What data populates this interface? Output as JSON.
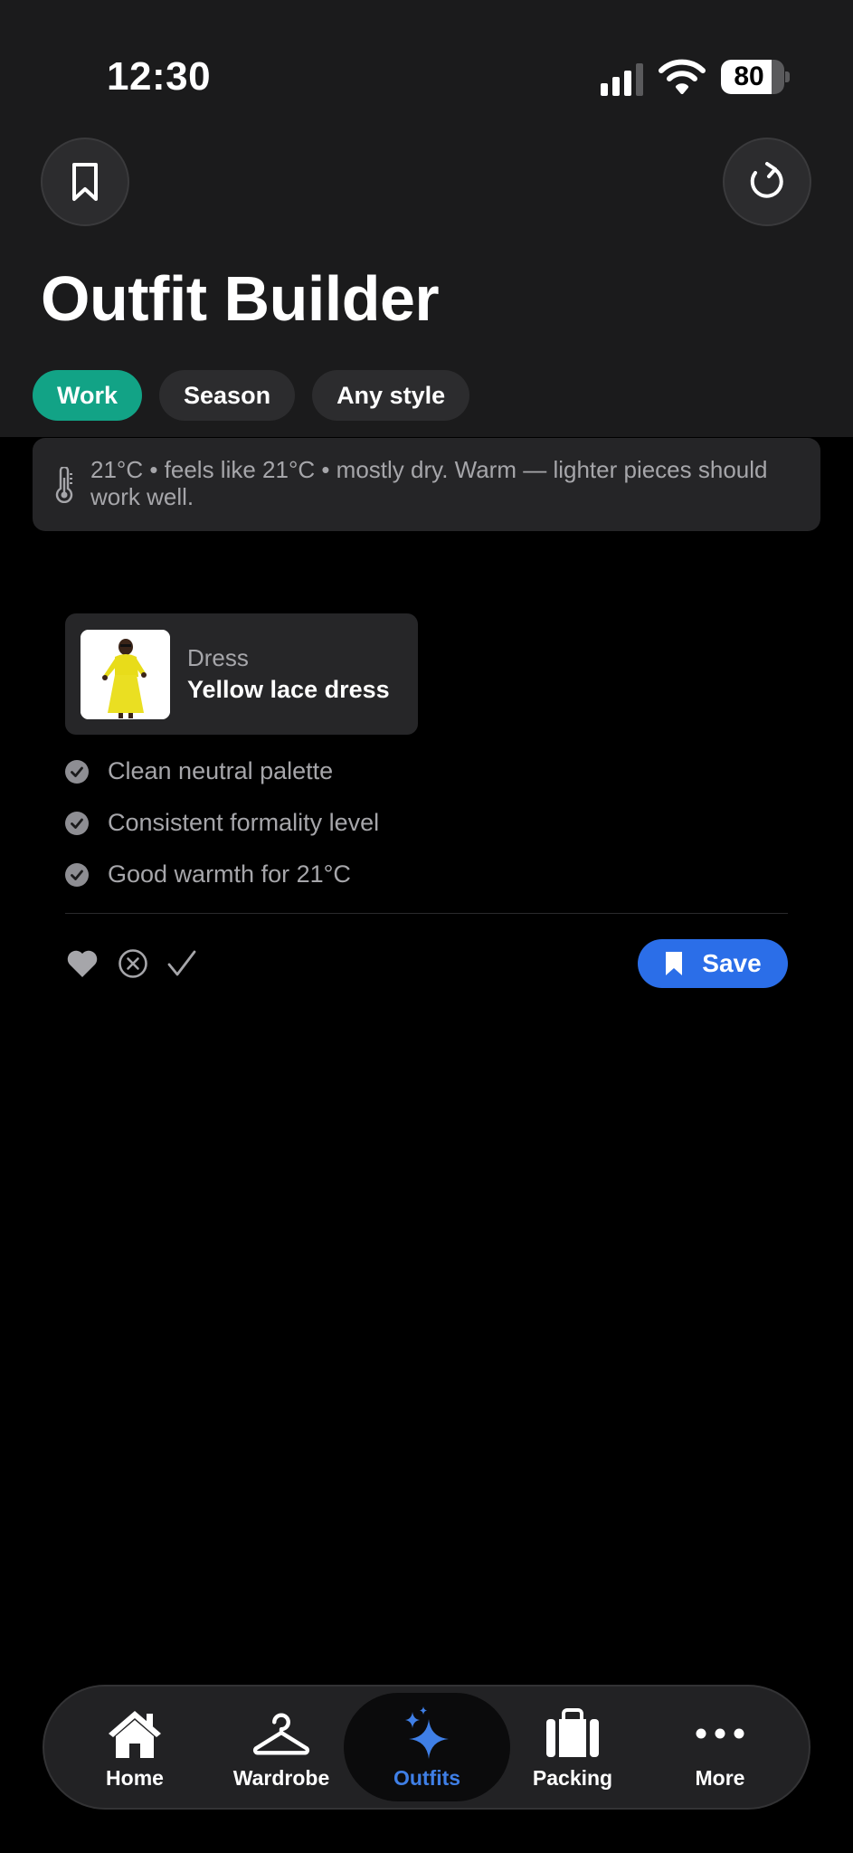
{
  "status_bar": {
    "time": "12:30",
    "battery_percent": "80",
    "battery_level": 0.8
  },
  "header": {
    "title": "Outfit Builder",
    "left_button_icon": "bookmark-icon",
    "right_button_icon": "refresh-icon"
  },
  "filters": [
    {
      "label": "Work",
      "active": true
    },
    {
      "label": "Season",
      "active": false
    },
    {
      "label": "Any style",
      "active": false
    }
  ],
  "weather": {
    "icon": "thermometer-icon",
    "text": "21°C • feels like 21°C • mostly dry. Warm — lighter pieces should work well."
  },
  "outfit": {
    "items": [
      {
        "category": "Dress",
        "name": "Yellow lace dress",
        "thumbnail": "yellow-dress-photo"
      }
    ],
    "reasons": [
      "Clean neutral palette",
      "Consistent formality level",
      "Good warmth for 21°C"
    ],
    "actions": {
      "like_icon": "heart-icon",
      "dismiss_icon": "x-circle-icon",
      "done_icon": "checkmark-icon",
      "save_label": "Save"
    }
  },
  "tab_bar": [
    {
      "label": "Home",
      "icon": "house-icon",
      "active": false
    },
    {
      "label": "Wardrobe",
      "icon": "hanger-icon",
      "active": false
    },
    {
      "label": "Outfits",
      "icon": "sparkles-icon",
      "active": true
    },
    {
      "label": "Packing",
      "icon": "suitcase-icon",
      "active": false
    },
    {
      "label": "More",
      "icon": "ellipsis-icon",
      "active": false
    }
  ],
  "colors": {
    "accent_green": "#12a386",
    "accent_blue": "#2b6ee8",
    "tab_active": "#3f7fe6",
    "header_bg": "#1b1b1c",
    "page_bg": "#000000"
  }
}
